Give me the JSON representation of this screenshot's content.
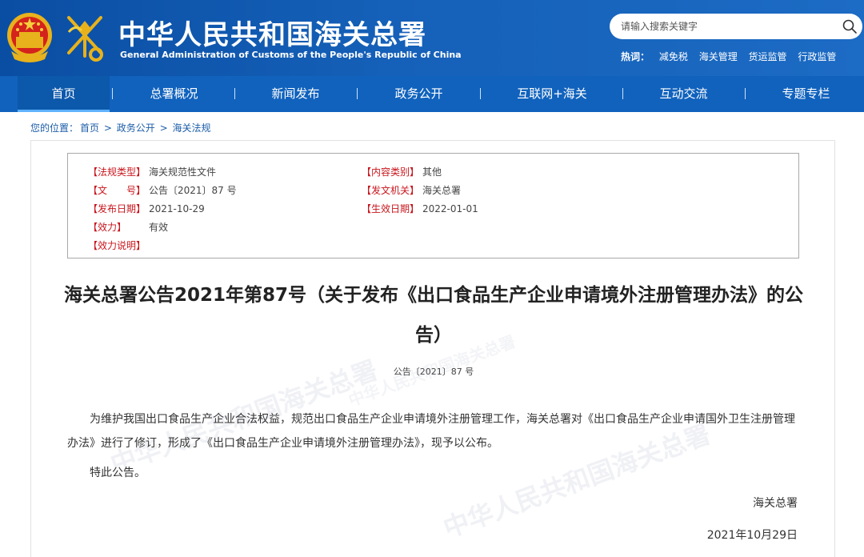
{
  "header": {
    "title": "中华人民共和国海关总署",
    "subtitle": "General Administration of Customs of the People's Republic of China",
    "search_placeholder": "请输入搜索关键字",
    "hot_label": "热词：",
    "hot_words": [
      "减免税",
      "海关管理",
      "货运监管",
      "行政监管"
    ]
  },
  "nav": {
    "items": [
      "首页",
      "总署概况",
      "新闻发布",
      "政务公开",
      "互联网+海关",
      "互动交流",
      "专题专栏"
    ],
    "separator": "|",
    "active_index": 0
  },
  "breadcrumb": {
    "prefix": "您的位置：",
    "items": [
      "首页",
      "政务公开",
      "海关法规"
    ],
    "separator": ">"
  },
  "meta": {
    "regulation_type": {
      "label": "【法规类型】",
      "value": "海关规范性文件"
    },
    "content_category": {
      "label": "【内容类别】",
      "value": "其他"
    },
    "doc_number": {
      "label": "【文　　号】",
      "value": "公告〔2021〕87 号"
    },
    "issuing_authority": {
      "label": "【发文机关】",
      "value": "海关总署"
    },
    "issue_date": {
      "label": "【发布日期】",
      "value": "2021-10-29"
    },
    "effective_date": {
      "label": "【生效日期】",
      "value": "2022-01-01"
    },
    "validity": {
      "label": "【效力】",
      "value": "有效"
    },
    "validity_note": {
      "label": "【效力说明】",
      "value": ""
    }
  },
  "document": {
    "title": "海关总署公告2021年第87号（关于发布《出口食品生产企业申请境外注册管理办法》的公告）",
    "number": "公告〔2021〕87 号",
    "paragraphs": [
      "为维护我国出口食品生产企业合法权益，规范出口食品生产企业申请境外注册管理工作，海关总署对《出口食品生产企业申请国外卫生注册管理办法》进行了修订，形成了《出口食品生产企业申请境外注册管理办法》，现予以公布。",
      "特此公告。"
    ],
    "signature": "海关总署",
    "date": "2021年10月29日"
  },
  "watermark": {
    "text": "中华人民共和国海关总署"
  },
  "colors": {
    "header_blue": "#0a4ea3",
    "nav_blue": "#1062bd",
    "label_red": "#c8161d",
    "link_blue": "#1d5ea8"
  }
}
